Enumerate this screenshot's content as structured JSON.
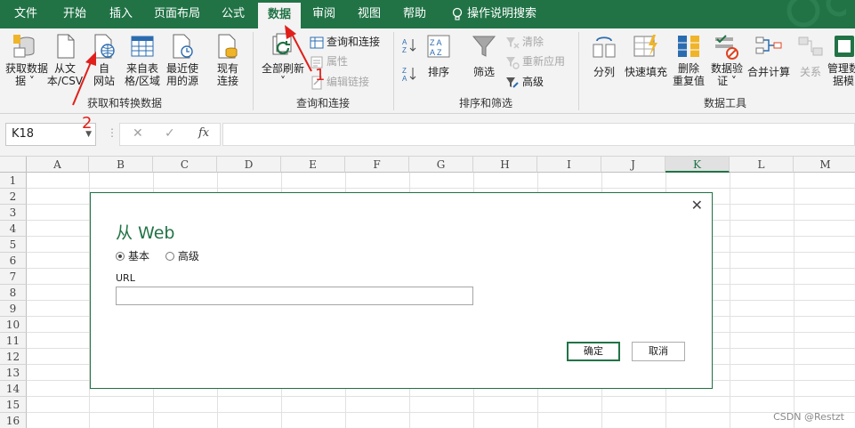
{
  "menu": {
    "tabs": [
      "文件",
      "开始",
      "插入",
      "页面布局",
      "公式",
      "数据",
      "审阅",
      "视图",
      "帮助"
    ],
    "active_tab": "数据",
    "tell_me": "操作说明搜索"
  },
  "ribbon": {
    "get_data": {
      "label": "获取和转换数据",
      "btn_get_data": "获取数据",
      "btn_get_data_2": "据",
      "btn_from_csv": "从文",
      "btn_from_csv_2": "本/CSV",
      "btn_from_web": "自",
      "btn_from_web_2": "网站",
      "btn_from_table": "来自表",
      "btn_from_table_2": "格/区域",
      "btn_recent": "最近使",
      "btn_recent_2": "用的源",
      "btn_existing": "现有",
      "btn_existing_2": "连接"
    },
    "queries": {
      "label": "查询和连接",
      "btn_refresh_all": "全部刷新",
      "btn_queries_conn": "查询和连接",
      "btn_properties": "属性",
      "btn_edit_links": "编辑链接"
    },
    "sort_filter": {
      "label": "排序和筛选",
      "btn_sort": "排序",
      "btn_filter": "筛选",
      "btn_clear": "清除",
      "btn_reapply": "重新应用",
      "btn_advanced": "高级"
    },
    "data_tools": {
      "label": "数据工具",
      "btn_split": "分列",
      "btn_flash_fill": "快速填充",
      "btn_remove_dup": "删除",
      "btn_remove_dup_2": "重复值",
      "btn_validation": "数据验",
      "btn_validation_2": "证",
      "btn_consolidate": "合并计算",
      "btn_relations": "关系",
      "btn_manage_model": "管理数",
      "btn_manage_model_2": "据模"
    }
  },
  "formula_bar": {
    "name_box": "K18",
    "fx_label": "fx"
  },
  "grid": {
    "columns": [
      "A",
      "B",
      "C",
      "D",
      "E",
      "F",
      "G",
      "H",
      "I",
      "J",
      "K",
      "L",
      "M"
    ],
    "selected_column": "K",
    "rows": [
      "1",
      "2",
      "3",
      "4",
      "5",
      "6",
      "7",
      "8",
      "9",
      "10",
      "11",
      "12",
      "13",
      "14",
      "15",
      "16"
    ]
  },
  "dialog": {
    "title": "从 Web",
    "radio_basic": "基本",
    "radio_advanced": "高级",
    "url_label": "URL",
    "url_value": "",
    "ok_label": "确定",
    "cancel_label": "取消",
    "close_glyph": "✕"
  },
  "annotations": {
    "step1": "1",
    "step2": "2"
  },
  "watermark": "CSDN @Restzt",
  "colors": {
    "accent": "#217346",
    "annotation": "#e0201b"
  }
}
